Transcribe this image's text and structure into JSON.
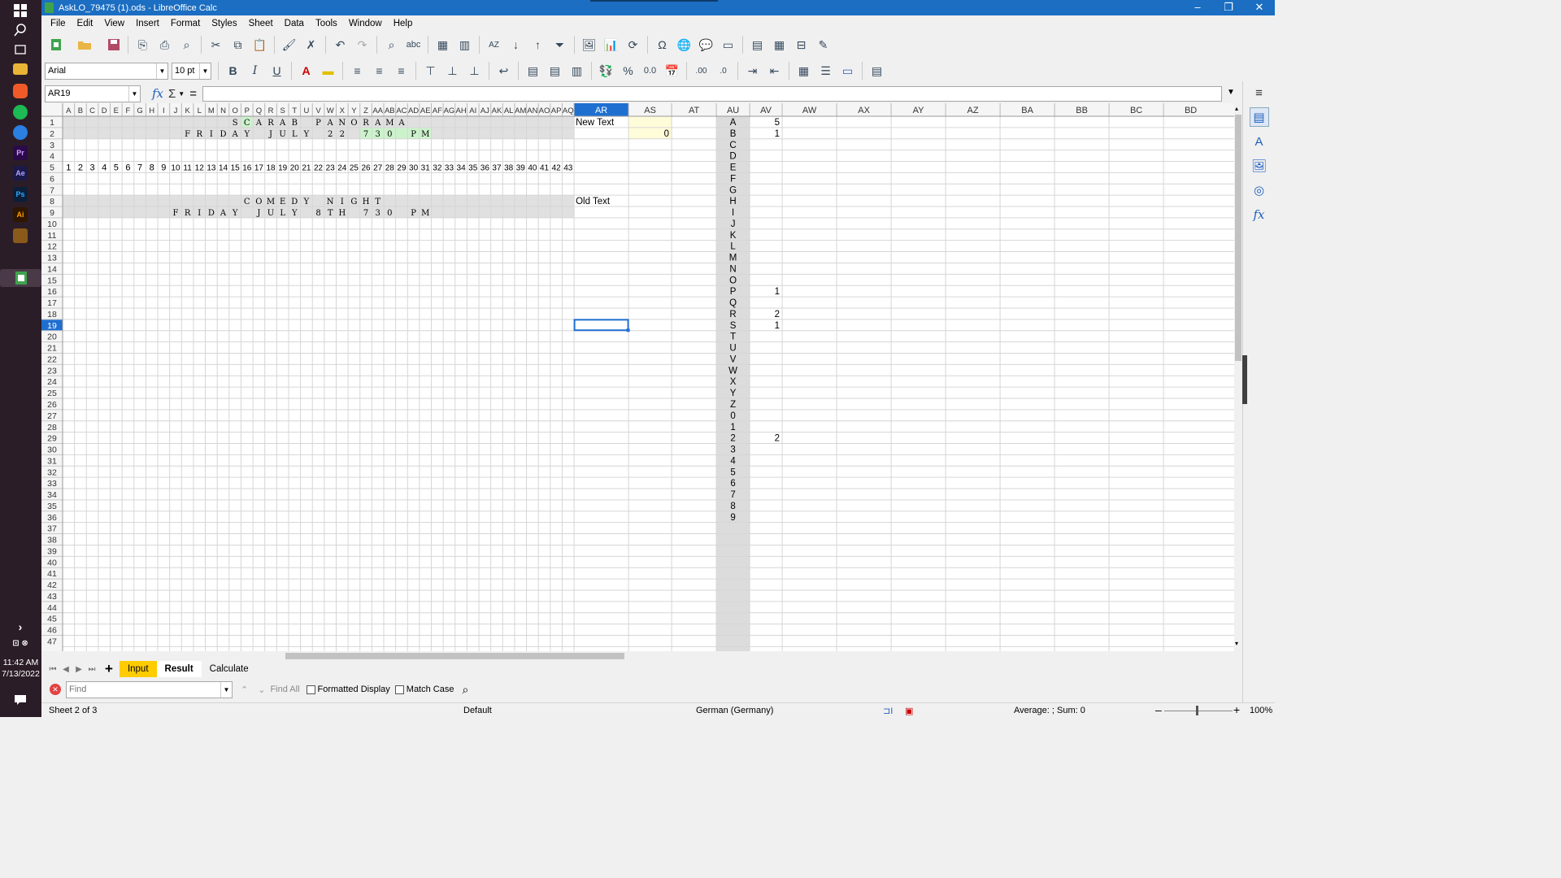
{
  "window": {
    "title": "AskLO_79475 (1).ods - LibreOffice Calc"
  },
  "taskbar": {
    "time": "11:42 AM",
    "date": "7/13/2022"
  },
  "menu": [
    "File",
    "Edit",
    "View",
    "Insert",
    "Format",
    "Styles",
    "Sheet",
    "Data",
    "Tools",
    "Window",
    "Help"
  ],
  "format_bar": {
    "font_name": "Arial",
    "font_size": "10 pt"
  },
  "formula_bar": {
    "name_box": "AR19",
    "formula": ""
  },
  "grid": {
    "narrow_columns": [
      "A",
      "B",
      "C",
      "D",
      "E",
      "F",
      "G",
      "H",
      "I",
      "J",
      "K",
      "L",
      "M",
      "N",
      "O",
      "P",
      "Q",
      "R",
      "S",
      "T",
      "U",
      "V",
      "W",
      "X",
      "Y",
      "Z",
      "AA",
      "AB",
      "AC",
      "AD",
      "AE",
      "AF",
      "AG",
      "AH",
      "AI",
      "AJ",
      "AK",
      "AL",
      "AM",
      "AN",
      "AO",
      "AP",
      "AQ"
    ],
    "wide_columns": [
      "AR",
      "AS",
      "AT",
      "AU",
      "AV",
      "AW",
      "AX",
      "AY",
      "AZ",
      "BA",
      "BB",
      "BC",
      "BD"
    ],
    "selected_column": "AR",
    "selected_row": 19,
    "row_count": 47,
    "row5_numbers": [
      1,
      2,
      3,
      4,
      5,
      6,
      7,
      8,
      9,
      10,
      11,
      12,
      13,
      14,
      15,
      16,
      17,
      18,
      19,
      20,
      21,
      22,
      23,
      24,
      25,
      26,
      27,
      28,
      29,
      30,
      31,
      32,
      33,
      34,
      35,
      36,
      37,
      38,
      39,
      40,
      41,
      42,
      43
    ],
    "row1_letters": [
      [
        "O",
        "S"
      ],
      [
        "P",
        "C"
      ],
      [
        "Q",
        "A"
      ],
      [
        "R",
        "R"
      ],
      [
        "S",
        "A"
      ],
      [
        "T",
        "B"
      ],
      [
        "V",
        "P"
      ],
      [
        "W",
        "A"
      ],
      [
        "X",
        "N"
      ],
      [
        "Y",
        "O"
      ],
      [
        "Z",
        "R"
      ],
      [
        "AA",
        "A"
      ],
      [
        "AB",
        "M"
      ],
      [
        "AC",
        "A"
      ]
    ],
    "row2_letters": [
      [
        "K",
        "F"
      ],
      [
        "L",
        "R"
      ],
      [
        "M",
        "I"
      ],
      [
        "N",
        "D"
      ],
      [
        "O",
        "A"
      ],
      [
        "P",
        "Y"
      ],
      [
        "R",
        "J"
      ],
      [
        "S",
        "U"
      ],
      [
        "T",
        "L"
      ],
      [
        "U",
        "Y"
      ],
      [
        "W",
        "2"
      ],
      [
        "X",
        "2"
      ],
      [
        "Z",
        "7"
      ],
      [
        "AA",
        "3"
      ],
      [
        "AB",
        "0"
      ],
      [
        "AD",
        "P"
      ],
      [
        "AE",
        "M"
      ]
    ],
    "row8_letters": [
      [
        "P",
        "C"
      ],
      [
        "Q",
        "O"
      ],
      [
        "R",
        "M"
      ],
      [
        "S",
        "E"
      ],
      [
        "T",
        "D"
      ],
      [
        "U",
        "Y"
      ],
      [
        "W",
        "N"
      ],
      [
        "X",
        "I"
      ],
      [
        "Y",
        "G"
      ],
      [
        "Z",
        "H"
      ],
      [
        "AA",
        "T"
      ]
    ],
    "row9_letters": [
      [
        "J",
        "F"
      ],
      [
        "K",
        "R"
      ],
      [
        "L",
        "I"
      ],
      [
        "M",
        "D"
      ],
      [
        "N",
        "A"
      ],
      [
        "O",
        "Y"
      ],
      [
        "Q",
        "J"
      ],
      [
        "R",
        "U"
      ],
      [
        "S",
        "L"
      ],
      [
        "T",
        "Y"
      ],
      [
        "V",
        "8"
      ],
      [
        "W",
        "T"
      ],
      [
        "X",
        "H"
      ],
      [
        "Z",
        "7"
      ],
      [
        "AA",
        "3"
      ],
      [
        "AB",
        "0"
      ],
      [
        "AD",
        "P"
      ],
      [
        "AE",
        "M"
      ]
    ],
    "labels": {
      "new_text": "New Text",
      "old_text": "Old Text",
      "as2": "0"
    },
    "au_column": [
      "A",
      "B",
      "C",
      "D",
      "E",
      "F",
      "G",
      "H",
      "I",
      "J",
      "K",
      "L",
      "M",
      "N",
      "O",
      "P",
      "Q",
      "R",
      "S",
      "T",
      "U",
      "V",
      "W",
      "X",
      "Y",
      "Z",
      "0",
      "1",
      "2",
      "3",
      "4",
      "5",
      "6",
      "7",
      "8",
      "9"
    ],
    "av_values": [
      {
        "row": 1,
        "value": "5"
      },
      {
        "row": 2,
        "value": "1"
      },
      {
        "row": 16,
        "value": "1"
      },
      {
        "row": 18,
        "value": "2"
      },
      {
        "row": 19,
        "value": "1"
      },
      {
        "row": 29,
        "value": "2"
      }
    ],
    "colors": {
      "grey_fill": "#e0e0e0",
      "green_fill": "#ccf2cc",
      "yellow_fill": "#fffcd9",
      "header_bg": "#f5f5f5",
      "selection": "#1f6fd1"
    }
  },
  "sheet_tabs": {
    "tabs": [
      "Input",
      "Result",
      "Calculate"
    ],
    "active": "Result",
    "input_color": "#ffcc00"
  },
  "find_bar": {
    "placeholder": "Find",
    "find_all": "Find All",
    "formatted_display": "Formatted Display",
    "match_case": "Match Case"
  },
  "status": {
    "sheet": "Sheet 2 of 3",
    "style": "Default",
    "language": "German (Germany)",
    "summary": "Average: ; Sum: 0",
    "zoom": "100%"
  }
}
